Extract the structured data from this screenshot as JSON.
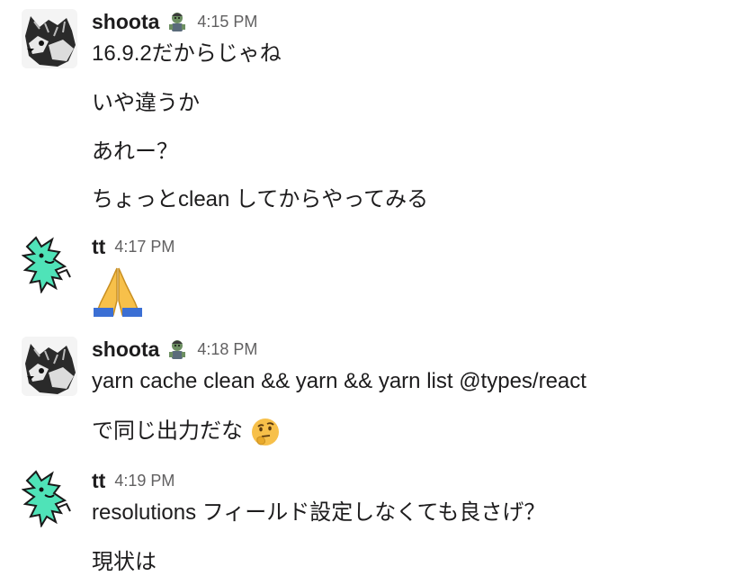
{
  "messages": [
    {
      "user": "shoota",
      "time": "4:15 PM",
      "lines": [
        "16.9.2だからじゃね",
        "いや違うか",
        "あれー？",
        "ちょっとclean してからやってみる"
      ]
    },
    {
      "user": "tt",
      "time": "4:17 PM",
      "emoji": "folded-hands-emoji"
    },
    {
      "user": "shoota",
      "time": "4:18 PM",
      "lines": [
        "yarn cache clean && yarn && yarn list @types/react",
        "で同じ出力だな"
      ],
      "line2_emoji": "thinking-face-emoji"
    },
    {
      "user": "tt",
      "time": "4:19 PM",
      "lines": [
        "resolutions フィールド設定しなくても良さげ？",
        "現状は"
      ]
    }
  ]
}
